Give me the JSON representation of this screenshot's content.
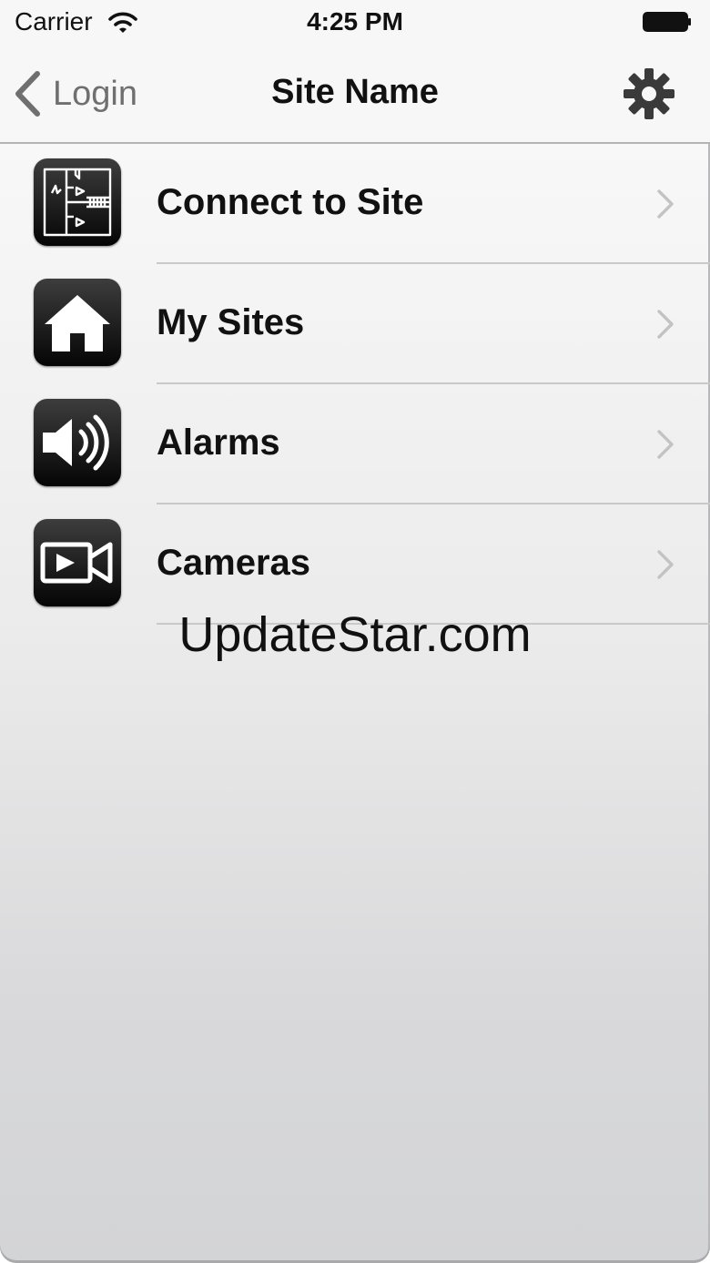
{
  "status_bar": {
    "carrier": "Carrier",
    "time": "4:25 PM",
    "wifi_icon": "wifi-icon",
    "battery_icon": "battery-icon"
  },
  "nav_bar": {
    "back_label": "Login",
    "back_icon": "chevron-left-icon",
    "title": "Site Name",
    "settings_icon": "gear-icon"
  },
  "menu": {
    "items": [
      {
        "label": "Connect to Site",
        "icon": "floor-plan-icon"
      },
      {
        "label": "My Sites",
        "icon": "home-icon"
      },
      {
        "label": "Alarms",
        "icon": "speaker-icon"
      },
      {
        "label": "Cameras",
        "icon": "video-camera-icon"
      }
    ],
    "chevron_icon": "chevron-right-icon"
  },
  "watermark": "UpdateStar.com",
  "colors": {
    "nav_background": "#f7f7f7",
    "text": "#111111",
    "back_text": "#6f6f6f",
    "divider": "#c9c9c9",
    "icon_tile": "#1a1a1a"
  }
}
